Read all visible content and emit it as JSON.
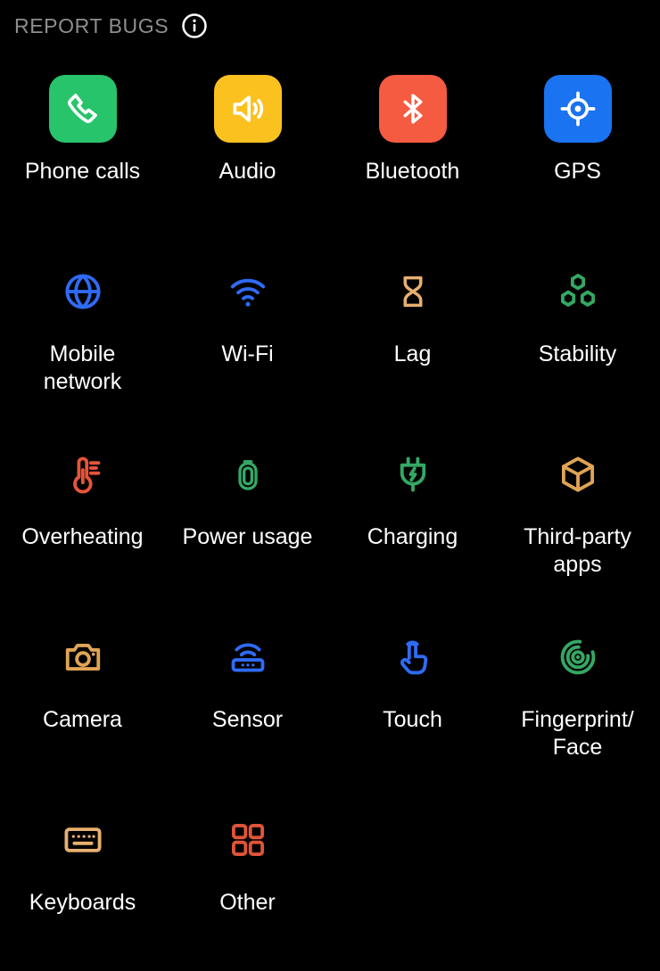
{
  "header": {
    "title": "REPORT BUGS",
    "info_icon": "info-circle-icon",
    "title_color": "#8e8e8e"
  },
  "theme": {
    "background": "#000000",
    "label_color": "#ffffff"
  },
  "grid": {
    "columns": 4,
    "items": [
      {
        "id": "phone-calls",
        "label": "Phone calls",
        "icon": "phone-handset-icon",
        "style": "filled",
        "bg_color": "#27c46b",
        "icon_color": "#ffffff"
      },
      {
        "id": "audio",
        "label": "Audio",
        "icon": "speaker-volume-icon",
        "style": "filled",
        "bg_color": "#fbc11f",
        "icon_color": "#ffffff"
      },
      {
        "id": "bluetooth",
        "label": "Bluetooth",
        "icon": "bluetooth-icon",
        "style": "filled",
        "bg_color": "#f55b41",
        "icon_color": "#ffffff"
      },
      {
        "id": "gps",
        "label": "GPS",
        "icon": "gps-target-icon",
        "style": "filled",
        "bg_color": "#1a73f0",
        "icon_color": "#ffffff"
      },
      {
        "id": "mobile-network",
        "label": "Mobile\nnetwork",
        "icon": "globe-icon",
        "style": "outline",
        "bg_color": "transparent",
        "icon_color": "#2f6bf5"
      },
      {
        "id": "wifi",
        "label": "Wi-Fi",
        "icon": "wifi-icon",
        "style": "outline",
        "bg_color": "transparent",
        "icon_color": "#2f6bf5"
      },
      {
        "id": "lag",
        "label": "Lag",
        "icon": "hourglass-icon",
        "style": "outline",
        "bg_color": "transparent",
        "icon_color": "#e8b071"
      },
      {
        "id": "stability",
        "label": "Stability",
        "icon": "hexagons-icon",
        "style": "outline",
        "bg_color": "transparent",
        "icon_color": "#34a864"
      },
      {
        "id": "overheating",
        "label": "Overheating",
        "icon": "thermometer-icon",
        "style": "outline",
        "bg_color": "transparent",
        "icon_color": "#e5543a"
      },
      {
        "id": "power-usage",
        "label": "Power usage",
        "icon": "battery-icon",
        "style": "outline",
        "bg_color": "transparent",
        "icon_color": "#34a864"
      },
      {
        "id": "charging",
        "label": "Charging",
        "icon": "charging-plug-icon",
        "style": "outline",
        "bg_color": "transparent",
        "icon_color": "#34a864"
      },
      {
        "id": "third-party-apps",
        "label": "Third-party\napps",
        "icon": "cube-icon",
        "style": "outline",
        "bg_color": "transparent",
        "icon_color": "#e0a455"
      },
      {
        "id": "camera",
        "label": "Camera",
        "icon": "camera-icon",
        "style": "outline",
        "bg_color": "transparent",
        "icon_color": "#e0a455"
      },
      {
        "id": "sensor",
        "label": "Sensor",
        "icon": "sensor-router-icon",
        "style": "outline",
        "bg_color": "transparent",
        "icon_color": "#2f6bf5"
      },
      {
        "id": "touch",
        "label": "Touch",
        "icon": "touch-hand-icon",
        "style": "outline",
        "bg_color": "transparent",
        "icon_color": "#2f6bf5"
      },
      {
        "id": "fingerprint-face",
        "label": "Fingerprint/\nFace",
        "icon": "fingerprint-icon",
        "style": "outline",
        "bg_color": "transparent",
        "icon_color": "#34a864"
      },
      {
        "id": "keyboards",
        "label": "Keyboards",
        "icon": "keyboard-icon",
        "style": "outline",
        "bg_color": "transparent",
        "icon_color": "#e8b071"
      },
      {
        "id": "other",
        "label": "Other",
        "icon": "grid-squares-icon",
        "style": "outline",
        "bg_color": "transparent",
        "icon_color": "#e0543a"
      }
    ]
  }
}
